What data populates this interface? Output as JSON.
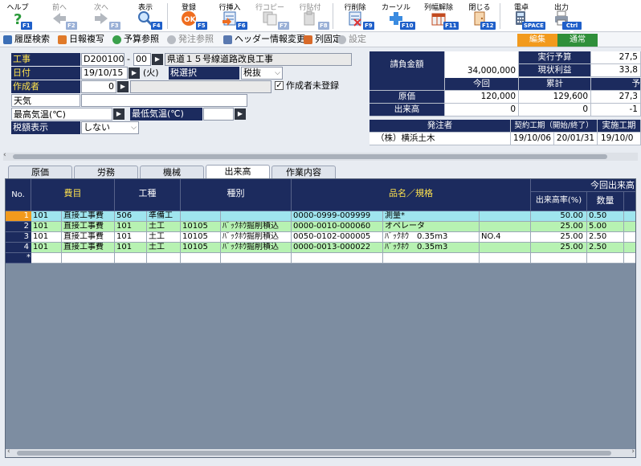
{
  "toolbar": {
    "help": {
      "label": "ヘルプ",
      "key": "F1"
    },
    "prev": {
      "label": "前へ",
      "key": "F2"
    },
    "next": {
      "label": "次へ",
      "key": "F3"
    },
    "show": {
      "label": "表示",
      "key": "F4"
    },
    "register": {
      "label": "登録",
      "key": "F5"
    },
    "row_insert": {
      "label": "行挿入",
      "key": "F6"
    },
    "row_copy": {
      "label": "行コピー",
      "key": "F7"
    },
    "row_paste": {
      "label": "行貼付",
      "key": "F8"
    },
    "row_delete": {
      "label": "行削除",
      "key": "F9"
    },
    "cursor": {
      "label": "カーソル",
      "key": "F10"
    },
    "col_release": {
      "label": "列幅解除",
      "key": "F11"
    },
    "close": {
      "label": "閉じる",
      "key": "F12"
    },
    "calc": {
      "label": "電卓",
      "key": "SPACE"
    },
    "output": {
      "label": "出力",
      "key": "Ctrl P"
    }
  },
  "bar2": {
    "history_search": "履歴検索",
    "daily_copy": "日報複写",
    "budget_ref": "予算参照",
    "order_ref": "発注参照",
    "header_change": "ヘッダー情報変更",
    "col_fix": "列固定",
    "settings": "設定",
    "mode_edit": "編集",
    "mode_normal": "通常"
  },
  "header": {
    "construction_label": "工事",
    "construction_code": "D2001001",
    "construction_sep": "-",
    "construction_sub": "00",
    "construction_name": "県道１５号線道路改良工事",
    "date_label": "日付",
    "date_value": "19/10/15",
    "date_weekday": "(火)",
    "tax_select_label": "税選択",
    "tax_select_value": "税抜",
    "author_label": "作成者",
    "author_value": "0",
    "author_unregistered_label": "作成者未登録",
    "author_unregistered_checked": true,
    "weather_label": "天気",
    "weather_value": "",
    "max_temp_label": "最高気温(℃)",
    "max_temp_value": "",
    "min_temp_label": "最低気温(℃)",
    "min_temp_value": "",
    "tax_display_label": "税額表示",
    "tax_display_value": "しない"
  },
  "summary": {
    "contract_amount_label": "請負金額",
    "contract_amount": "34,000,000",
    "exec_budget_label": "実行予算",
    "exec_budget": "27,5",
    "current_profit_label": "現状利益",
    "current_profit": "33,8",
    "col_this_time": "今回",
    "col_cumulative": "累計",
    "col_budget": "予",
    "cost_label": "原価",
    "cost_this_time": "120,000",
    "cost_cumulative": "129,600",
    "cost_budget": "27,3",
    "progress_label": "出来高",
    "progress_this_time": "0",
    "progress_cumulative": "0",
    "progress_budget": "-1",
    "orderer_label": "発注者",
    "contract_period_label": "契約工期（開始/終了）",
    "actual_period_label": "実施工期",
    "orderer_value": "（株）横浜土木",
    "contract_start": "19/10/06",
    "contract_end": "20/01/31",
    "actual_start": "19/10/0"
  },
  "tabs": [
    "原価",
    "労務",
    "機械",
    "出来高",
    "作業内容"
  ],
  "active_tab": "出来高",
  "grid": {
    "headers": {
      "no": "No.",
      "cost_item": "費目",
      "work_type": "工種",
      "kind": "種別",
      "product": "品名／規格",
      "this_progress_group": "今回出来高",
      "progress_rate": "出来高率(%)",
      "quantity": "数量"
    },
    "rows": [
      {
        "no": "1",
        "c1": "101",
        "c2": "直接工事費",
        "c3": "506",
        "c4": "準備工",
        "c5": "",
        "c6": "",
        "c7": "0000-0999-009999",
        "c8": "測量*",
        "c9": "",
        "rate": "50.00",
        "qty": "0.50"
      },
      {
        "no": "2",
        "c1": "101",
        "c2": "直接工事費",
        "c3": "101",
        "c4": "土工",
        "c5": "10105",
        "c6": "ﾊﾞｯｸﾎｳ掘削積込",
        "c7": "0000-0010-000060",
        "c8": "オペレータ",
        "c9": "",
        "rate": "25.00",
        "qty": "5.00"
      },
      {
        "no": "3",
        "c1": "101",
        "c2": "直接工事費",
        "c3": "101",
        "c4": "土工",
        "c5": "10105",
        "c6": "ﾊﾞｯｸﾎｳ掘削積込",
        "c7": "0050-0102-000005",
        "c8": "ﾊﾞｯｸﾎｳ　0.35m3",
        "c9": "NO.4",
        "rate": "25.00",
        "qty": "2.50"
      },
      {
        "no": "4",
        "c1": "101",
        "c2": "直接工事費",
        "c3": "101",
        "c4": "土工",
        "c5": "10105",
        "c6": "ﾊﾞｯｸﾎｳ掘削積込",
        "c7": "0000-0013-000022",
        "c8": "ﾊﾞｯｸﾎｳ　0.35m3",
        "c9": "",
        "rate": "25.00",
        "qty": "2.50"
      }
    ],
    "new_row_marker": "*"
  },
  "colors": {
    "header_navy": "#1c2b5e",
    "label_yellow": "#ffe34d",
    "row_cyan": "#9fe5ee",
    "row_green": "#b7f2b2",
    "row_white": "#ffffff",
    "selected_orange": "#f29a1d",
    "grid_bg": "#7d8da1"
  }
}
